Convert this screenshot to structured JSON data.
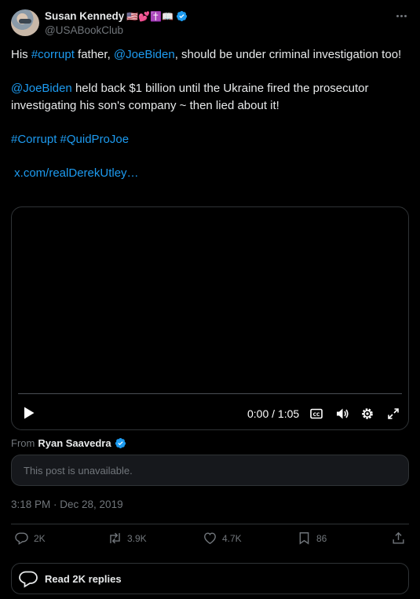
{
  "author": {
    "display_name": "Susan Kennedy",
    "emojis": "🇺🇸💕✝️📖",
    "handle": "@USABookClub",
    "verified": true
  },
  "post": {
    "line1_pre": "His ",
    "line1_tag": "#corrupt",
    "line1_mid": " father, ",
    "line1_mention": "@JoeBiden",
    "line1_post": ", should be under criminal investigation too!",
    "line2_mention": "@JoeBiden",
    "line2_text": " held back $1 billion until the Ukraine fired the prosecutor investigating his son's company ~ then lied about it!",
    "hashtag1": "#Corrupt",
    "hashtag2": "#QuidProJoe",
    "link": "x.com/realDerekUtley…"
  },
  "video": {
    "time": "0:00 / 1:05",
    "progress": 0.0
  },
  "attribution": {
    "prefix": "From",
    "name": "Ryan Saavedra"
  },
  "quote_unavailable": "This post is unavailable.",
  "timestamp": "3:18 PM · Dec 28, 2019",
  "actions": {
    "replies": "2K",
    "reposts": "3.9K",
    "likes": "4.7K",
    "bookmarks": "86"
  },
  "read_replies": "Read 2K replies",
  "colors": {
    "accent": "#1d9bf0",
    "background": "#000000",
    "muted": "#71767b",
    "border": "#2f3336"
  }
}
